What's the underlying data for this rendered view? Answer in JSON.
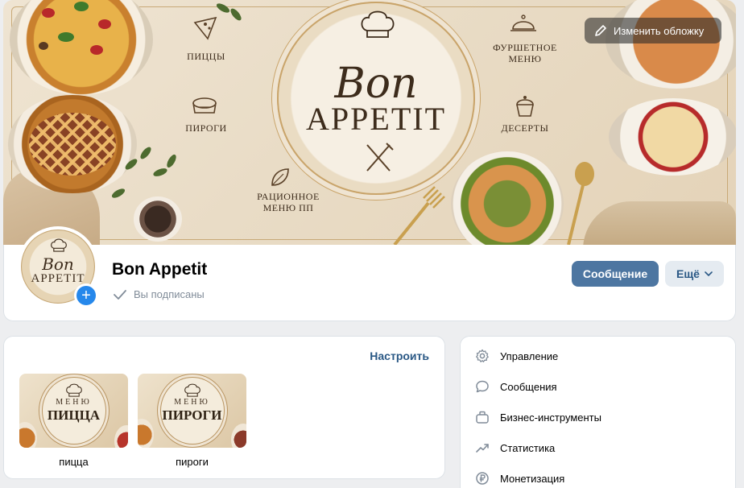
{
  "cover": {
    "edit_label": "Изменить обложку",
    "medallion": {
      "line1": "Bon",
      "line2": "APPETIT"
    },
    "labels": {
      "pizza": "ПИЦЦЫ",
      "pies": "ПИРОГИ",
      "diet_line1": "РАЦИОННОЕ",
      "diet_line2": "МЕНЮ ПП",
      "buffet_line1": "ФУРШЕТНОЕ",
      "buffet_line2": "МЕНЮ",
      "desserts": "ДЕСЕРТЫ"
    }
  },
  "group": {
    "name": "Bon Appetit",
    "subscribed_label": "Вы подписаны",
    "avatar": {
      "line1": "Bon",
      "line2": "APPETIT"
    },
    "message_button": "Сообщение",
    "more_button": "Ещё"
  },
  "albums": {
    "configure_label": "Настроить",
    "items": [
      {
        "menu_word": "МЕНЮ",
        "title": "ПИЦЦА",
        "caption": "пицца"
      },
      {
        "menu_word": "МЕНЮ",
        "title": "ПИРОГИ",
        "caption": "пироги"
      }
    ]
  },
  "side_menu": {
    "items": [
      {
        "label": "Управление",
        "icon": "gear-icon"
      },
      {
        "label": "Сообщения",
        "icon": "chat-bubble-icon"
      },
      {
        "label": "Бизнес-инструменты",
        "icon": "briefcase-icon"
      },
      {
        "label": "Статистика",
        "icon": "trend-chart-icon"
      },
      {
        "label": "Монетизация",
        "icon": "ruble-coin-icon"
      }
    ]
  },
  "colors": {
    "primary_button": "#4d76a1",
    "secondary_button": "#e5ebf1",
    "link": "#2a5885",
    "avatar_add": "#2688eb",
    "page_background": "#edeef0",
    "muted_text": "#818c99"
  }
}
